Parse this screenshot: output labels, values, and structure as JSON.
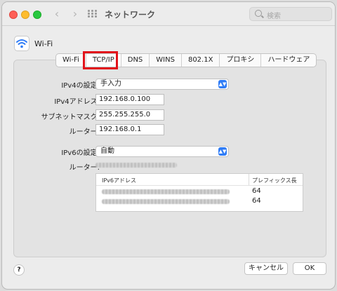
{
  "window": {
    "title": "ネットワーク"
  },
  "toolbar": {
    "back_glyph": "‹",
    "forward_glyph": "›",
    "search_placeholder": "検索"
  },
  "service": {
    "name": "Wi-Fi"
  },
  "tabs": [
    {
      "label": "Wi-Fi"
    },
    {
      "label": "TCP/IP"
    },
    {
      "label": "DNS"
    },
    {
      "label": "WINS"
    },
    {
      "label": "802.1X"
    },
    {
      "label": "プロキシ"
    },
    {
      "label": "ハードウェア"
    }
  ],
  "selected_tab": "TCP/IP",
  "ipv4": {
    "config_label": "IPv4の設定:",
    "config_value": "手入力",
    "address_label": "IPv4アドレス:",
    "address_value": "192.168.0.100",
    "subnet_label": "サブネットマスク:",
    "subnet_value": "255.255.255.0",
    "router_label": "ルーター:",
    "router_value": "192.168.0.1"
  },
  "ipv6": {
    "config_label": "IPv6の設定:",
    "config_value": "自動",
    "router_label": "ルーター:",
    "table": {
      "headers": [
        "IPv6アドレス",
        "プレフィックス長"
      ],
      "rows": [
        {
          "prefix": "64"
        },
        {
          "prefix": "64"
        }
      ]
    }
  },
  "footer": {
    "help_label": "?",
    "cancel_label": "キャンセル",
    "ok_label": "OK"
  },
  "colors": {
    "highlight": "#e2131b",
    "accent": "#2f7cf6"
  },
  "icons": [
    "wifi-icon",
    "search-icon",
    "grid-icon",
    "chevron-left-icon",
    "chevron-right-icon",
    "chevron-updown-icon",
    "help-icon"
  ]
}
